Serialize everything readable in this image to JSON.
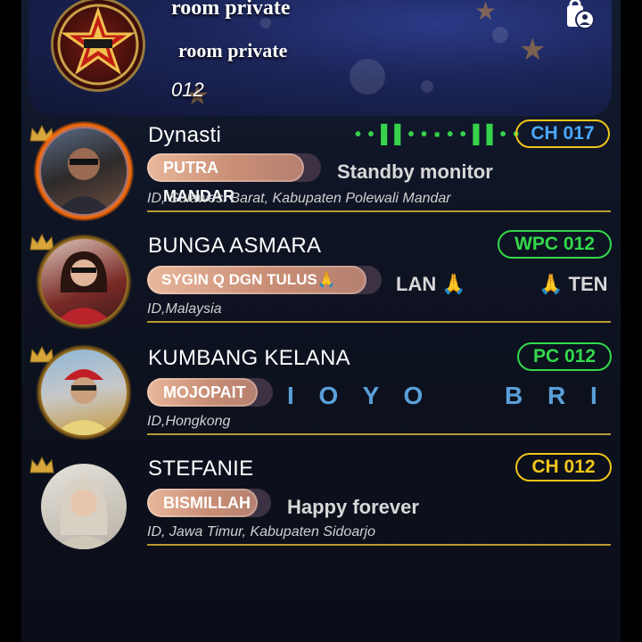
{
  "room": {
    "title": "room private",
    "subtitle": "room private",
    "number": "012",
    "lock_icon": "lock-person-icon"
  },
  "users": [
    {
      "name": "Dynasti",
      "tag": "PUTRA MANDAR",
      "status": "Standby monitor",
      "location": "ID, Sulawesi Barat, Kabupaten Polewali Mandar",
      "channel": "CH 017",
      "channel_color": "#4aa8ff",
      "audio_indicator": "• • ▌▌• • ▪ • • ▌▌• •",
      "frame": "fire-frame"
    },
    {
      "name": "BUNGA ASMARA",
      "tag": "SYGIN Q DGN TULUS🙏",
      "status": "LAN 🙏",
      "status_tail": "🙏 TEN",
      "location": "ID,Malaysia",
      "channel": "WPC 012",
      "channel_color": "#33d94a",
      "frame": "gold-frame"
    },
    {
      "name": "KUMBANG KELANA",
      "tag": "MOJOPAIT",
      "status": "I O Y O",
      "status_tail": "B R I",
      "location": "ID,Hongkong",
      "channel": "PC 012",
      "channel_color": "#33d94a",
      "frame": "gold-frame"
    },
    {
      "name": "STEFANIE",
      "tag": "BISMILLAH",
      "status": "Happy forever",
      "location": "ID, Jawa Timur, Kabupaten Sidoarjo",
      "channel": "CH 012",
      "channel_color": "#f0c419",
      "frame": "none"
    }
  ]
}
